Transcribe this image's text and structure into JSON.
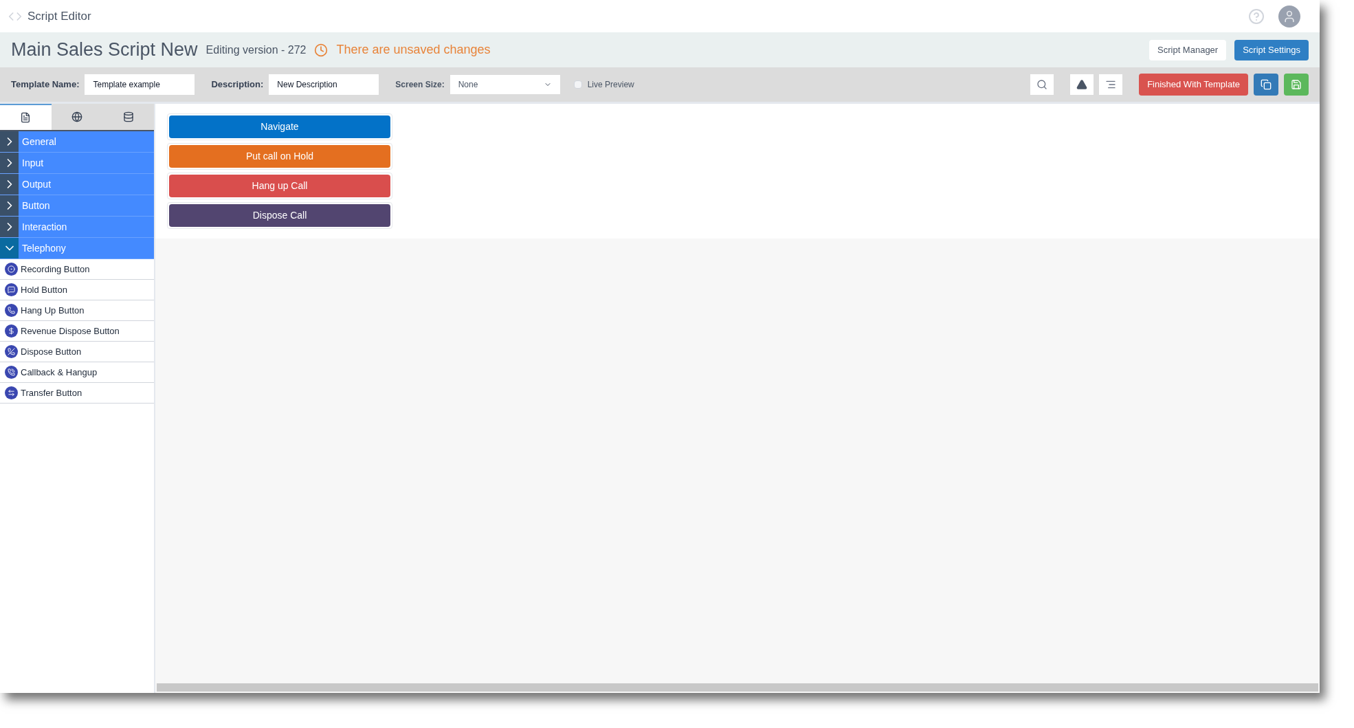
{
  "app_bar": {
    "title": "Script Editor"
  },
  "title_bar": {
    "title": "Main Sales Script New",
    "version": "Editing version - 272",
    "warning": "There are unsaved changes",
    "buttons": [
      {
        "label": "Script Manager",
        "kind": "plain"
      },
      {
        "label": "Script Settings",
        "kind": "primary"
      }
    ]
  },
  "toolbar": {
    "template_name": {
      "label": "Template Name:",
      "value": "Template example"
    },
    "description": {
      "label": "Description:",
      "value": "New Description"
    },
    "screen_size": {
      "label": "Screen Size:",
      "value": "None"
    },
    "live_preview": {
      "label": "Live Preview",
      "checked": false
    },
    "finish_button": "Finished With Template"
  },
  "sidebar": {
    "tabs": [
      {
        "kind": "list",
        "selected": true
      },
      {
        "kind": "globe",
        "selected": false
      },
      {
        "kind": "database",
        "selected": false
      }
    ],
    "categories": [
      {
        "label": "General",
        "expanded": false
      },
      {
        "label": "Input",
        "expanded": false
      },
      {
        "label": "Output",
        "expanded": false
      },
      {
        "label": "Button",
        "expanded": false
      },
      {
        "label": "Interaction",
        "expanded": false
      },
      {
        "label": "Telephony",
        "expanded": true,
        "children": [
          {
            "label": "Recording Button",
            "kind": "record"
          },
          {
            "label": "Hold Button",
            "kind": "hold"
          },
          {
            "label": "Hang Up Button",
            "kind": "hangup"
          },
          {
            "label": "Revenue Dispose Button",
            "kind": "revenue"
          },
          {
            "label": "Dispose Button",
            "kind": "dispose"
          },
          {
            "label": "Callback & Hangup",
            "kind": "callback"
          },
          {
            "label": "Transfer Button",
            "kind": "transfer"
          }
        ]
      }
    ]
  },
  "canvas": {
    "buttons": [
      {
        "label": "Navigate",
        "color": "#0372c8"
      },
      {
        "label": "Put call on Hold",
        "color": "#e46f20"
      },
      {
        "label": "Hang up Call",
        "color": "#d94e4d"
      },
      {
        "label": "Dispose Call",
        "color": "#524570"
      }
    ]
  }
}
